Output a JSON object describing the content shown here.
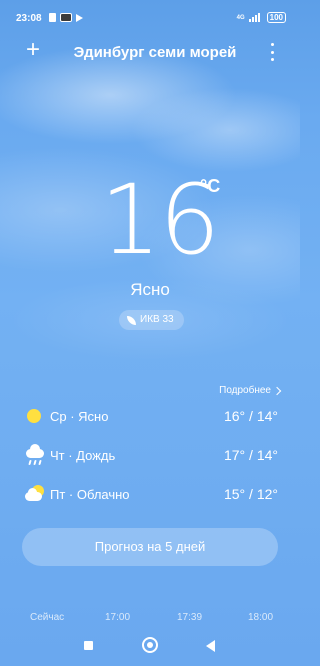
{
  "status_bar": {
    "time": "23:08",
    "network": "4G",
    "battery": "100"
  },
  "header": {
    "add_icon": "plus-icon",
    "city": "Эдинбург семи морей",
    "menu_icon": "more-vertical-icon"
  },
  "current": {
    "temperature": "16",
    "unit": "°C",
    "condition": "Ясно",
    "aqi_label": "ИКВ 33"
  },
  "forecast": {
    "more_label": "Подробнее",
    "days": [
      {
        "icon": "sun-icon",
        "label": "Ср · Ясно",
        "temps": "16° / 14°"
      },
      {
        "icon": "rain-icon",
        "label": "Чт · Дождь",
        "temps": "17° / 14°"
      },
      {
        "icon": "partly-cloudy-icon",
        "label": "Пт · Облачно",
        "temps": "15° / 12°"
      }
    ],
    "button_label": "Прогноз на 5 дней"
  },
  "hourly": [
    "Сейчас",
    "17:00",
    "17:39",
    "18:00"
  ],
  "colors": {
    "sky_top": "#5d9fe8",
    "sky_bottom": "#6aa8ef",
    "sun": "#ffe040"
  }
}
